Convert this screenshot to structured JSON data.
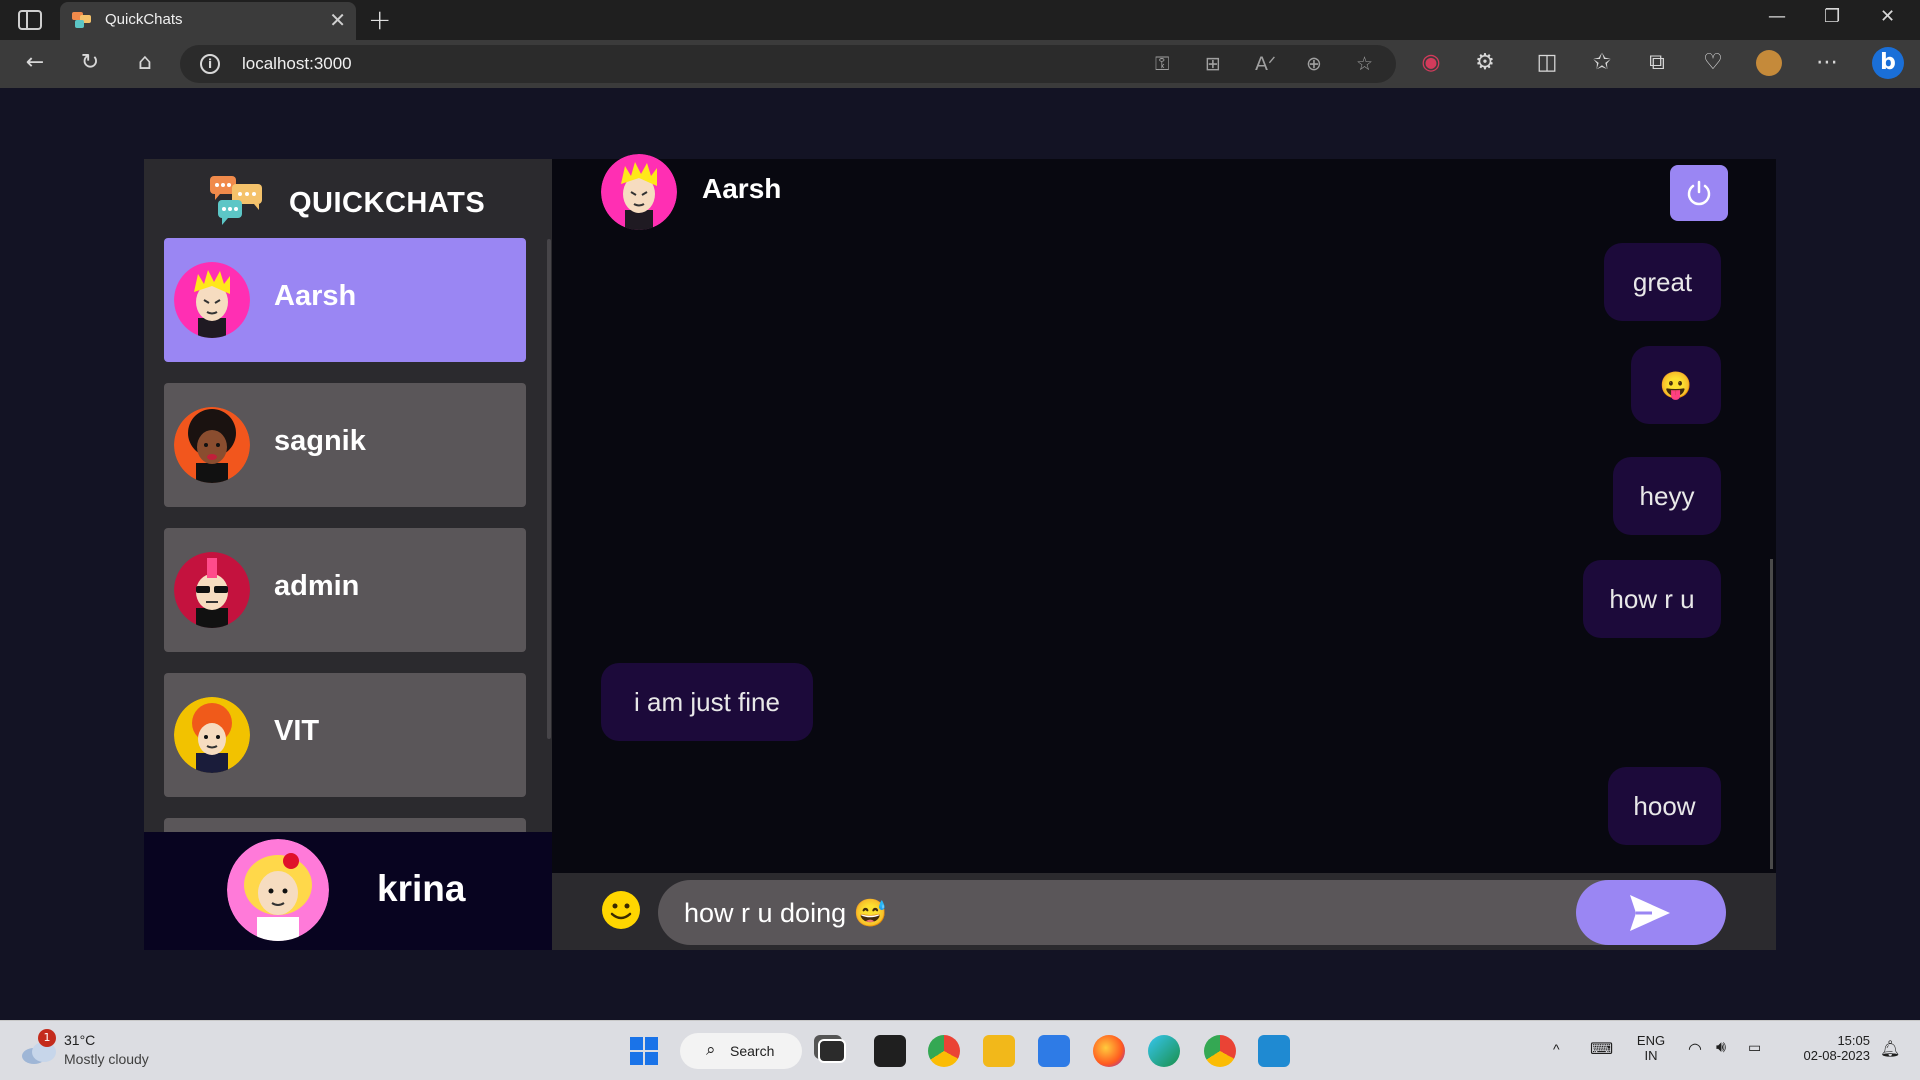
{
  "browser": {
    "tab_title": "QuickChats",
    "url": "localhost:3000"
  },
  "app": {
    "brand": "QUICKCHATS",
    "contacts": [
      {
        "name": "Aarsh",
        "selected": true
      },
      {
        "name": "sagnik",
        "selected": false
      },
      {
        "name": "admin",
        "selected": false
      },
      {
        "name": "VIT",
        "selected": false
      }
    ],
    "current_user": "krina",
    "chat_header_name": "Aarsh",
    "messages": [
      {
        "text": "great",
        "direction": "sent"
      },
      {
        "text": "😛",
        "direction": "sent"
      },
      {
        "text": "heyy",
        "direction": "sent"
      },
      {
        "text": "how r u",
        "direction": "sent"
      },
      {
        "text": "i am just fine",
        "direction": "received"
      },
      {
        "text": "hoow",
        "direction": "sent"
      }
    ],
    "input_value": "how r u doing 😅",
    "colors": {
      "accent": "#9a86f3",
      "bubble": "#1c0a3a",
      "panel": "#2b2a2e"
    }
  },
  "taskbar": {
    "weather_temp": "31°C",
    "weather_desc": "Mostly cloudy",
    "weather_badge": "1",
    "search_label": "Search",
    "lang_top": "ENG",
    "lang_bottom": "IN",
    "time": "15:05",
    "date": "02-08-2023"
  }
}
